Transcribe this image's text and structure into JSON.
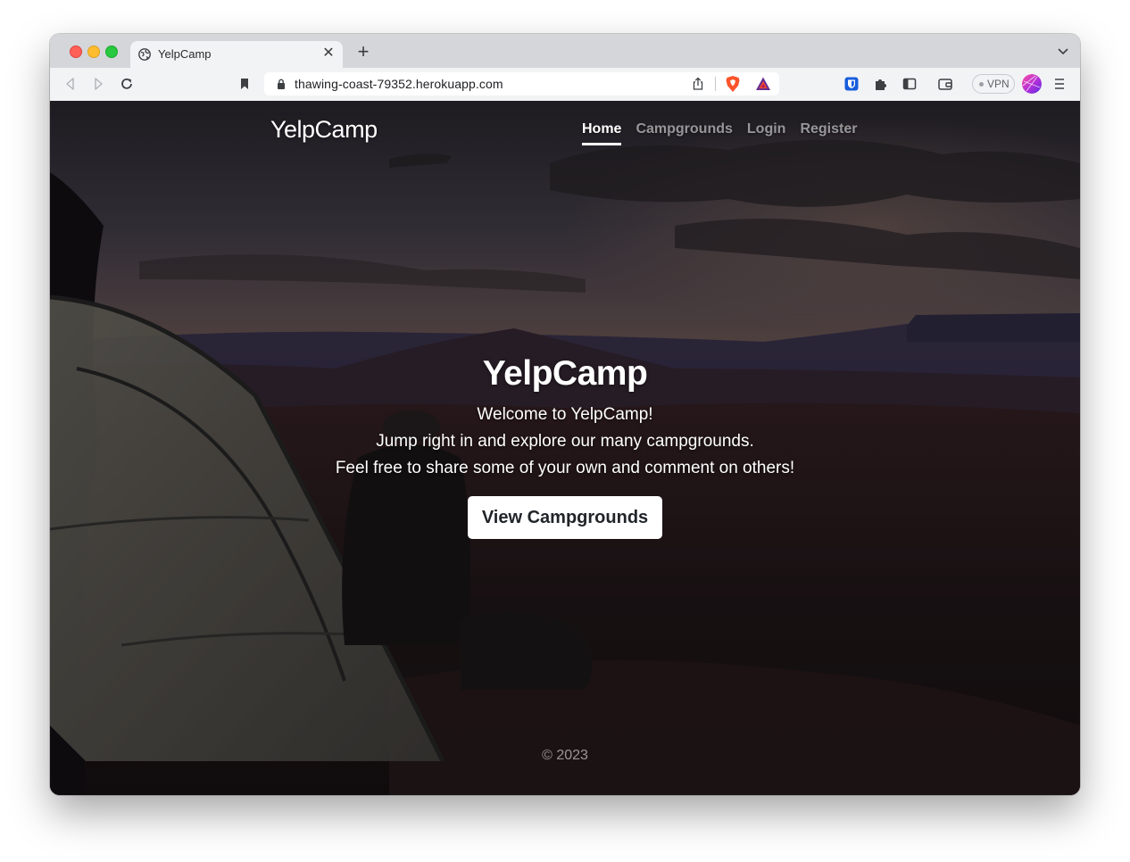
{
  "browser": {
    "tab": {
      "title": "YelpCamp"
    },
    "address_bar": {
      "url": "thawing-coast-79352.herokuapp.com"
    },
    "vpn_label": "VPN"
  },
  "navbar": {
    "brand": "YelpCamp",
    "links": [
      {
        "label": "Home",
        "active": true
      },
      {
        "label": "Campgrounds",
        "active": false
      },
      {
        "label": "Login",
        "active": false
      },
      {
        "label": "Register",
        "active": false
      }
    ]
  },
  "hero": {
    "title": "YelpCamp",
    "lines": [
      "Welcome to YelpCamp!",
      "Jump right in and explore our many campgrounds.",
      "Feel free to share some of your own and comment on others!"
    ],
    "cta_label": "View Campgrounds"
  },
  "footer": {
    "text": "© 2023"
  },
  "icons": [
    "globe-icon",
    "close-icon",
    "plus-icon",
    "chevron-down-icon",
    "back-icon",
    "forward-icon",
    "reload-icon",
    "bookmark-icon",
    "lock-icon",
    "share-icon",
    "brave-shield-icon",
    "bat-rewards-icon",
    "bitwarden-icon",
    "extensions-icon",
    "sidebar-icon",
    "wallet-icon",
    "profile-avatar",
    "menu-icon"
  ],
  "colors": {
    "cta_bg": "#ffffff",
    "cta_text": "#212529",
    "nav_active": "#ffffff"
  }
}
